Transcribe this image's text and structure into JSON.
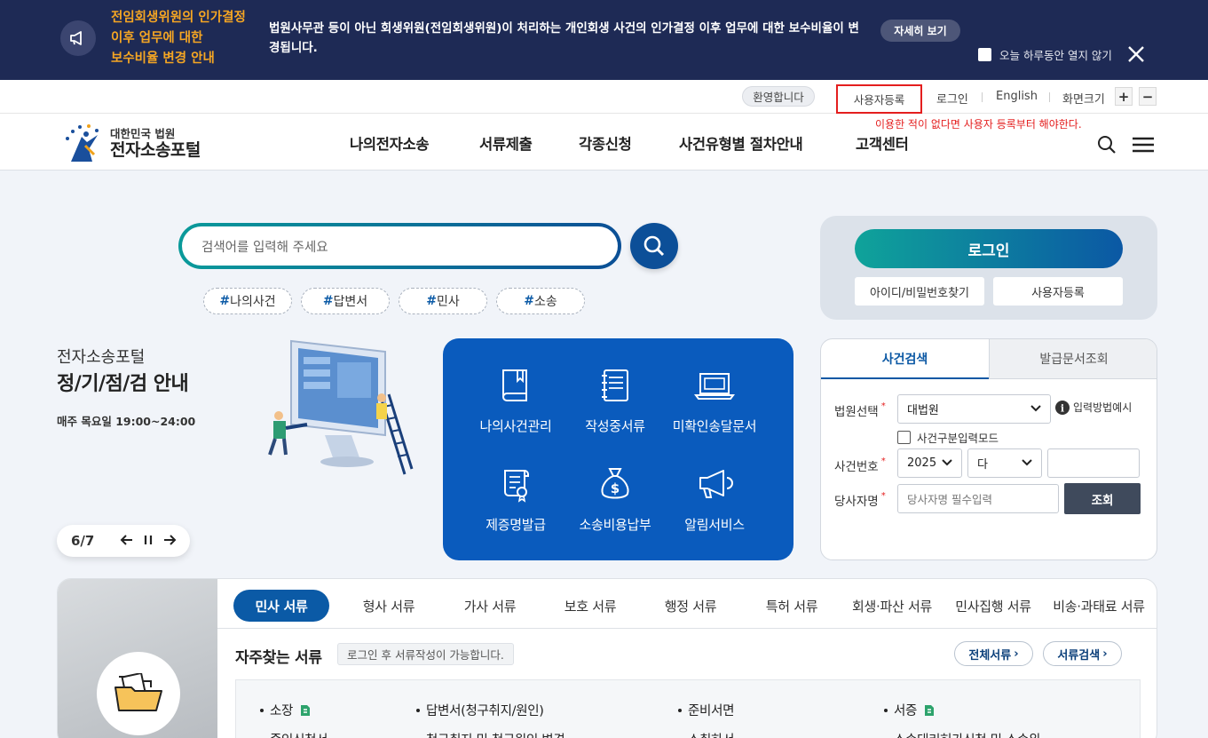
{
  "notice": {
    "title_lines": [
      "전임회생위원의 인가결정",
      "이후 업무에 대한",
      "보수비율 변경 안내"
    ],
    "body": "법원사무관 등이 아닌 회생위원(전임회생위원)이 처리하는 개인회생 사건의 인가결정 이후 업무에 대한 보수비율이 변경됩니다.",
    "more_label": "자세히 보기",
    "hide_today_label": "오늘 하루동안 열지 않기"
  },
  "util": {
    "welcome": "환영합니다",
    "register": "사용자등록",
    "login": "로그인",
    "english": "English",
    "font_size": "화면크기",
    "plus": "+",
    "minus": "−"
  },
  "annotation": "이용한 적이 없다면 사용자 등록부터 해야한다.",
  "logo": {
    "court": "대한민국 법원",
    "name": "전자소송포털"
  },
  "gnb": [
    "나의전자소송",
    "서류제출",
    "각종신청",
    "사건유형별 절차안내",
    "고객센터"
  ],
  "search": {
    "placeholder": "검색어를 입력해 주세요",
    "tags": [
      "나의사건",
      "답변서",
      "민사",
      "소송"
    ]
  },
  "promo": {
    "subtitle": "전자소송포털",
    "title": "정/기/점/검 안내",
    "time": "매주 목요일 19:00~24:00",
    "pager": "6/7"
  },
  "quick_menu": [
    {
      "label": "나의사건관리",
      "icon": "book-icon"
    },
    {
      "label": "작성중서류",
      "icon": "notebook-icon"
    },
    {
      "label": "미확인송달문서",
      "icon": "laptop-icon"
    },
    {
      "label": "제증명발급",
      "icon": "certificate-icon"
    },
    {
      "label": "소송비용납부",
      "icon": "money-bag-icon"
    },
    {
      "label": "알림서비스",
      "icon": "megaphone-icon"
    }
  ],
  "login": {
    "button": "로그인",
    "find": "아이디/비밀번호찾기",
    "register": "사용자등록"
  },
  "case_search": {
    "tabs": [
      "사건검색",
      "발급문서조회"
    ],
    "court_label": "법원선택",
    "court_value": "대법원",
    "input_example": "입력방법예시",
    "case_type_mode": "사건구분입력모드",
    "case_no_label": "사건번호",
    "year_value": "2025",
    "type_value": "다",
    "party_label": "당사자명",
    "party_placeholder": "당사자명 필수입력",
    "search_button": "조회",
    "required_mark": "*"
  },
  "docs": {
    "tabs": [
      "민사 서류",
      "형사 서류",
      "가사 서류",
      "보호 서류",
      "행정 서류",
      "특허 서류",
      "회생·파산 서류",
      "민사집행 서류",
      "비송·과태료 서류"
    ],
    "frequent_title": "자주찾는 서류",
    "frequent_note": "로그인 후 서류작성이 가능합니다.",
    "all_docs": "전체서류",
    "doc_search": "서류검색",
    "items_row1": [
      "소장",
      "답변서(청구취지/원인)",
      "준비서면",
      "서증"
    ],
    "items_row2": [
      "증인신청서",
      "청구취지 및 청구원인 변경",
      "소취하서",
      "소송대리허가신청 및 소송위"
    ]
  },
  "colors": {
    "banner_bg": "#1e2a55",
    "banner_title": "#f5a623",
    "primary": "#0b5aa6",
    "quick_menu_bg": "#0a5bbd",
    "annotation_red": "#e41e1e"
  }
}
